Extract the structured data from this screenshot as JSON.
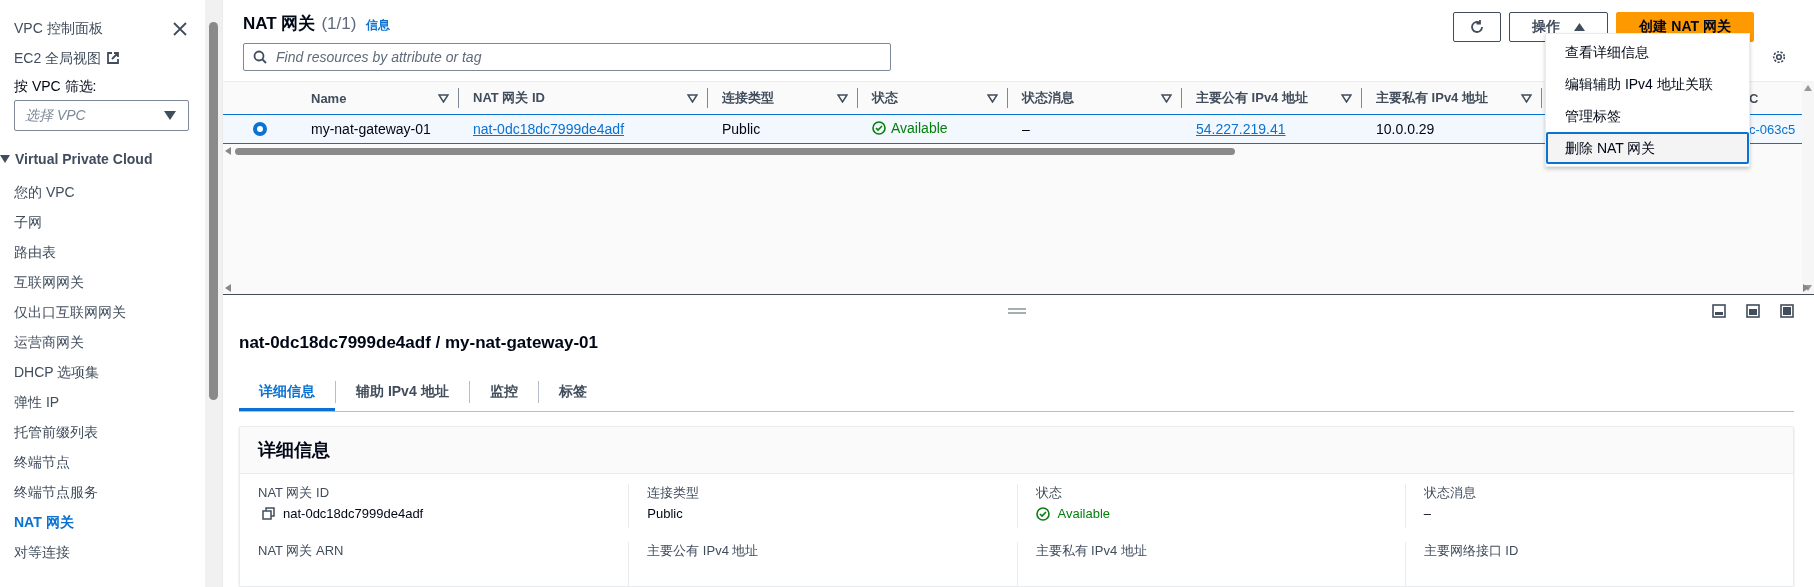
{
  "sidebar": {
    "links": [
      {
        "label": "VPC 控制面板",
        "external": false
      },
      {
        "label": "EC2 全局视图",
        "external": true
      }
    ],
    "filter": {
      "label": "按 VPC 筛选:",
      "placeholder": "选择 VPC"
    },
    "section": {
      "title": "Virtual Private Cloud",
      "expanded": true,
      "items": [
        {
          "label": "您的 VPC",
          "selected": false
        },
        {
          "label": "子网",
          "selected": false
        },
        {
          "label": "路由表",
          "selected": false
        },
        {
          "label": "互联网网关",
          "selected": false
        },
        {
          "label": "仅出口互联网网关",
          "selected": false
        },
        {
          "label": "运营商网关",
          "selected": false
        },
        {
          "label": "DHCP 选项集",
          "selected": false
        },
        {
          "label": "弹性 IP",
          "selected": false
        },
        {
          "label": "托管前缀列表",
          "selected": false
        },
        {
          "label": "终端节点",
          "selected": false
        },
        {
          "label": "终端节点服务",
          "selected": false
        },
        {
          "label": "NAT 网关",
          "selected": true
        },
        {
          "label": "对等连接",
          "selected": false
        }
      ]
    }
  },
  "header": {
    "title": "NAT 网关",
    "count": "(1/1)",
    "info": "信息"
  },
  "toolbar": {
    "actions_label": "操作",
    "actions_expanded": true,
    "create_label": "创建 NAT 网关"
  },
  "search": {
    "placeholder": "Find resources by attribute or tag"
  },
  "table": {
    "columns": [
      {
        "label": "Name",
        "sortable": true
      },
      {
        "label": "NAT 网关 ID",
        "sortable": true
      },
      {
        "label": "连接类型",
        "sortable": true
      },
      {
        "label": "状态",
        "sortable": true
      },
      {
        "label": "状态消息",
        "sortable": true
      },
      {
        "label": "主要公有 IPv4 地址",
        "sortable": true
      },
      {
        "label": "主要私有 IPv4 地址",
        "sortable": true
      },
      {
        "label": "C",
        "sortable": false
      }
    ],
    "rows": [
      {
        "selected": true,
        "cells": [
          {
            "kind": "text",
            "text": "my-nat-gateway-01"
          },
          {
            "kind": "link",
            "text": "nat-0dc18dc7999de4adf"
          },
          {
            "kind": "text",
            "text": "Public"
          },
          {
            "kind": "status",
            "text": "Available"
          },
          {
            "kind": "text",
            "text": "–"
          },
          {
            "kind": "link",
            "text": "54.227.219.41"
          },
          {
            "kind": "text",
            "text": "10.0.0.29"
          },
          {
            "kind": "plainlink",
            "text": "c-063c5"
          }
        ]
      }
    ]
  },
  "actions_menu": {
    "items": [
      {
        "label": "查看详细信息",
        "selected": false
      },
      {
        "label": "编辑辅助 IPv4 地址关联",
        "selected": false
      },
      {
        "label": "管理标签",
        "selected": false
      },
      {
        "label": "删除 NAT 网关",
        "selected": true
      }
    ]
  },
  "details": {
    "title": "nat-0dc18dc7999de4adf / my-nat-gateway-01",
    "tabs": [
      {
        "label": "详细信息",
        "selected": true
      },
      {
        "label": "辅助 IPv4 地址",
        "selected": false
      },
      {
        "label": "监控",
        "selected": false
      },
      {
        "label": "标签",
        "selected": false
      }
    ],
    "card_title": "详细信息",
    "fields": [
      {
        "label": "NAT 网关 ID",
        "kind": "copy",
        "value": "nat-0dc18dc7999de4adf"
      },
      {
        "label": "连接类型",
        "kind": "text",
        "value": "Public"
      },
      {
        "label": "状态",
        "kind": "status",
        "value": "Available"
      },
      {
        "label": "状态消息",
        "kind": "text",
        "value": "–"
      },
      {
        "label": "NAT 网关 ARN",
        "kind": "empty"
      },
      {
        "label": "主要公有 IPv4 地址",
        "kind": "empty"
      },
      {
        "label": "主要私有 IPv4 地址",
        "kind": "empty"
      },
      {
        "label": "主要网络接口 ID",
        "kind": "empty"
      }
    ]
  }
}
